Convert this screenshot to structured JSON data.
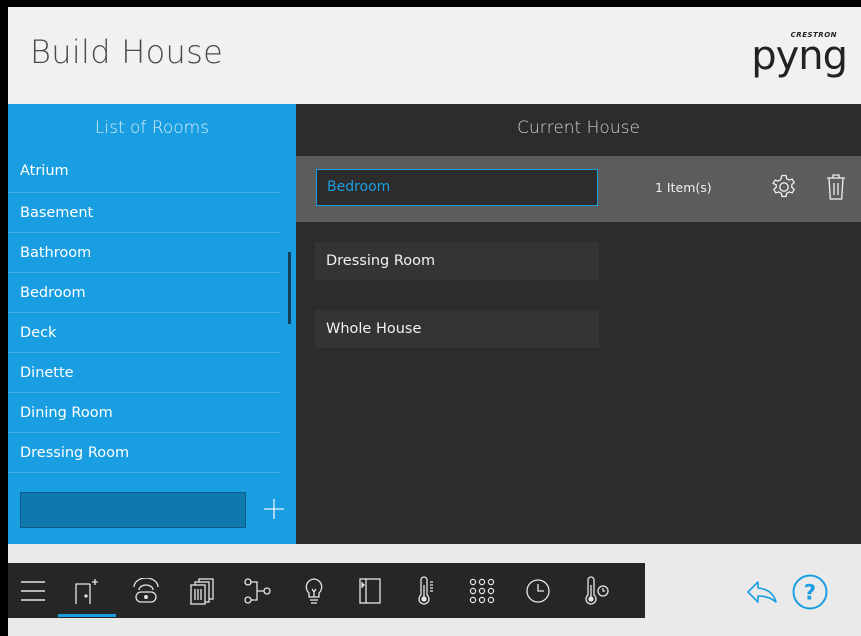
{
  "header": {
    "title": "Build House",
    "logo_top": "CRESTRON",
    "logo_main": "pyng"
  },
  "rooms_panel": {
    "title": "List of Rooms",
    "items": [
      "Atrium",
      "Basement",
      "Bathroom",
      "Bedroom",
      "Deck",
      "Dinette",
      "Dining Room",
      "Dressing Room"
    ],
    "input_value": "",
    "add_icon": "plus-icon"
  },
  "house_panel": {
    "title": "Current House",
    "selected": {
      "name": "Bedroom",
      "count": "1 Item(s)",
      "settings_icon": "gear-icon",
      "delete_icon": "trash-icon"
    },
    "items": [
      "Dressing Room",
      "Whole House"
    ]
  },
  "toolbar": {
    "icons": [
      "menu-icon",
      "room-add-icon",
      "remote-icon",
      "shades-icon",
      "sequence-icon",
      "light-bulb-icon",
      "door-icon",
      "thermometer-icon",
      "keypad-icon",
      "clock-icon",
      "sensor-icon"
    ],
    "active": "room-add-icon"
  },
  "nav": {
    "back_icon": "back-arrow-icon",
    "help_icon": "help-icon"
  },
  "colors": {
    "accent": "#1a9ee2",
    "dark_panel": "#2c2c2c",
    "selected_row": "#5c5c5c",
    "toolbar": "#262626"
  }
}
